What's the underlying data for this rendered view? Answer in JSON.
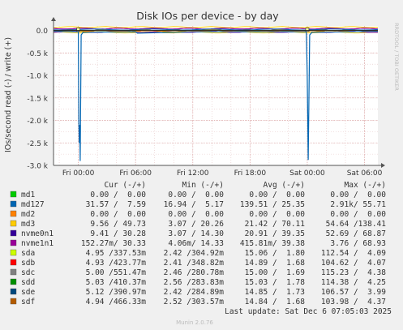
{
  "chart_data": {
    "type": "line",
    "title": "Disk IOs per device - by day",
    "ylabel": "IOs/second read (-) / write (+)",
    "side_label": "RRDTOOL / TOBI OETIKER",
    "ylim": [
      -3.0,
      0.1
    ],
    "y_ticks": [
      0.0,
      -0.5,
      -1.0,
      -1.5,
      -2.0,
      -2.5,
      -3.0
    ],
    "y_tick_labels": [
      "0.0",
      "-0.5 k",
      "-1.0 k",
      "-1.5 k",
      "-2.0 k",
      "-2.5 k",
      "-3.0 k"
    ],
    "y_unit": "thousand IOs/second",
    "x_tick_labels": [
      "Fri 00:00",
      "Fri 06:00",
      "Fri 12:00",
      "Fri 18:00",
      "Sat 00:00",
      "Sat 06:00"
    ],
    "x_range_hours": [
      -2.6,
      31.4
    ],
    "grid": true,
    "series": [
      {
        "name": "md1",
        "color": "#00cc00"
      },
      {
        "name": "md127",
        "color": "#0066b3"
      },
      {
        "name": "md2",
        "color": "#ff8000"
      },
      {
        "name": "md3",
        "color": "#ffcc00"
      },
      {
        "name": "nvme0n1",
        "color": "#330099"
      },
      {
        "name": "nvme1n1",
        "color": "#990099"
      },
      {
        "name": "sda",
        "color": "#ccff00"
      },
      {
        "name": "sdb",
        "color": "#ff0000"
      },
      {
        "name": "sdc",
        "color": "#808080"
      },
      {
        "name": "sdd",
        "color": "#008f00"
      },
      {
        "name": "sde",
        "color": "#00487d"
      },
      {
        "name": "sdf",
        "color": "#b35a00"
      }
    ],
    "md127_read_profile": [
      {
        "x": -2.6,
        "y": -0.02
      },
      {
        "x": 0.0,
        "y": -0.03
      },
      {
        "x": 0.05,
        "y": -2.0
      },
      {
        "x": 0.1,
        "y": -2.5
      },
      {
        "x": 0.15,
        "y": -2.1
      },
      {
        "x": 0.2,
        "y": -2.9
      },
      {
        "x": 0.3,
        "y": -0.1
      },
      {
        "x": 0.5,
        "y": -0.04
      },
      {
        "x": 6.0,
        "y": -0.03
      },
      {
        "x": 6.2,
        "y": -0.06
      },
      {
        "x": 12.0,
        "y": -0.03
      },
      {
        "x": 23.9,
        "y": -0.03
      },
      {
        "x": 24.0,
        "y": -1.0
      },
      {
        "x": 24.1,
        "y": -2.88
      },
      {
        "x": 24.25,
        "y": -0.1
      },
      {
        "x": 24.5,
        "y": -0.04
      },
      {
        "x": 31.4,
        "y": -0.02
      }
    ]
  },
  "legend_table": {
    "headers": [
      "Cur (-/+)",
      "Min (-/+)",
      "Avg (-/+)",
      "Max (-/+)"
    ],
    "rows": [
      {
        "name": "md1",
        "cur": "0.00 /  0.00",
        "min": "0.00 /  0.00",
        "avg": "0.00 /  0.00",
        "max": "0.00 /  0.00"
      },
      {
        "name": "md127",
        "cur": "31.57 /  7.59",
        "min": "16.94 /  5.17",
        "avg": "139.51 / 25.35",
        "max": "2.91k/ 55.71"
      },
      {
        "name": "md2",
        "cur": "0.00 /  0.00",
        "min": "0.00 /  0.00",
        "avg": "0.00 /  0.00",
        "max": "0.00 /  0.00"
      },
      {
        "name": "md3",
        "cur": "9.56 / 49.73",
        "min": "3.07 / 20.26",
        "avg": "21.42 / 70.11",
        "max": "54.64 /138.41"
      },
      {
        "name": "nvme0n1",
        "cur": "9.41 / 30.28",
        "min": "3.07 / 14.30",
        "avg": "20.91 / 39.35",
        "max": "52.69 / 68.87"
      },
      {
        "name": "nvme1n1",
        "cur": "152.27m/ 30.33",
        "min": "4.06m/ 14.33",
        "avg": "415.81m/ 39.38",
        "max": "3.76 / 68.93"
      },
      {
        "name": "sda",
        "cur": "4.95 /337.53m",
        "min": "2.42 /304.92m",
        "avg": "15.06 /  1.80",
        "max": "112.54 /  4.09"
      },
      {
        "name": "sdb",
        "cur": "4.93 /423.77m",
        "min": "2.41 /348.82m",
        "avg": "14.89 /  1.68",
        "max": "104.62 /  4.07"
      },
      {
        "name": "sdc",
        "cur": "5.00 /551.47m",
        "min": "2.46 /280.78m",
        "avg": "15.00 /  1.69",
        "max": "115.23 /  4.38"
      },
      {
        "name": "sdd",
        "cur": "5.03 /410.37m",
        "min": "2.56 /283.83m",
        "avg": "15.03 /  1.78",
        "max": "114.38 /  4.25"
      },
      {
        "name": "sde",
        "cur": "5.12 /390.97m",
        "min": "2.42 /284.89m",
        "avg": "14.85 /  1.73",
        "max": "106.57 /  3.99"
      },
      {
        "name": "sdf",
        "cur": "4.94 /466.33m",
        "min": "2.52 /303.57m",
        "avg": "14.84 /  1.68",
        "max": "103.98 /  4.37"
      }
    ]
  },
  "footer": {
    "last_update": "Last update: Sat Dec  6 07:05:03 2025",
    "version": "Munin 2.0.76"
  }
}
